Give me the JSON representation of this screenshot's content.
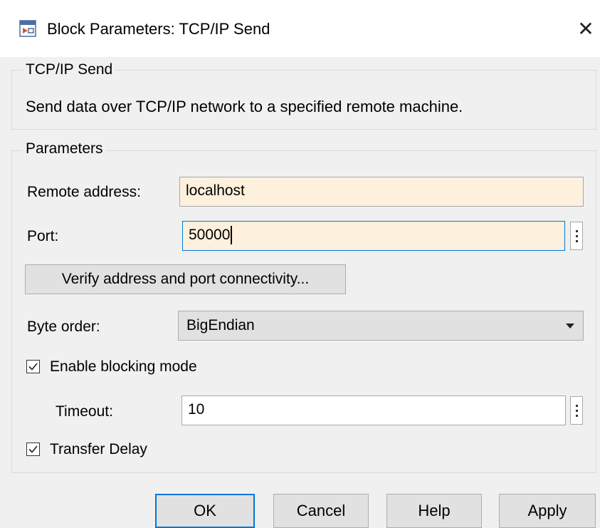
{
  "window": {
    "title": "Block Parameters: TCP/IP Send",
    "icon": "simulink-block-icon",
    "close_glyph": "✕"
  },
  "block_group": {
    "legend": "TCP/IP Send",
    "description": "Send data over TCP/IP network to a specified remote machine."
  },
  "parameters": {
    "legend": "Parameters",
    "remote_address": {
      "label": "Remote address:",
      "value": "localhost"
    },
    "port": {
      "label": "Port:",
      "value": "50000"
    },
    "verify_button": "Verify address and port connectivity...",
    "byte_order": {
      "label": "Byte order:",
      "value": "BigEndian"
    },
    "blocking_mode": {
      "label": "Enable blocking mode",
      "checked": true
    },
    "timeout": {
      "label": "Timeout:",
      "value": "10"
    },
    "transfer_delay": {
      "label": "Transfer Delay",
      "checked": true
    }
  },
  "buttons": {
    "ok": "OK",
    "cancel": "Cancel",
    "help": "Help",
    "apply": "Apply"
  },
  "colors": {
    "edited_field_bg": "#fdf0dc",
    "focus_border": "#0078d7"
  }
}
